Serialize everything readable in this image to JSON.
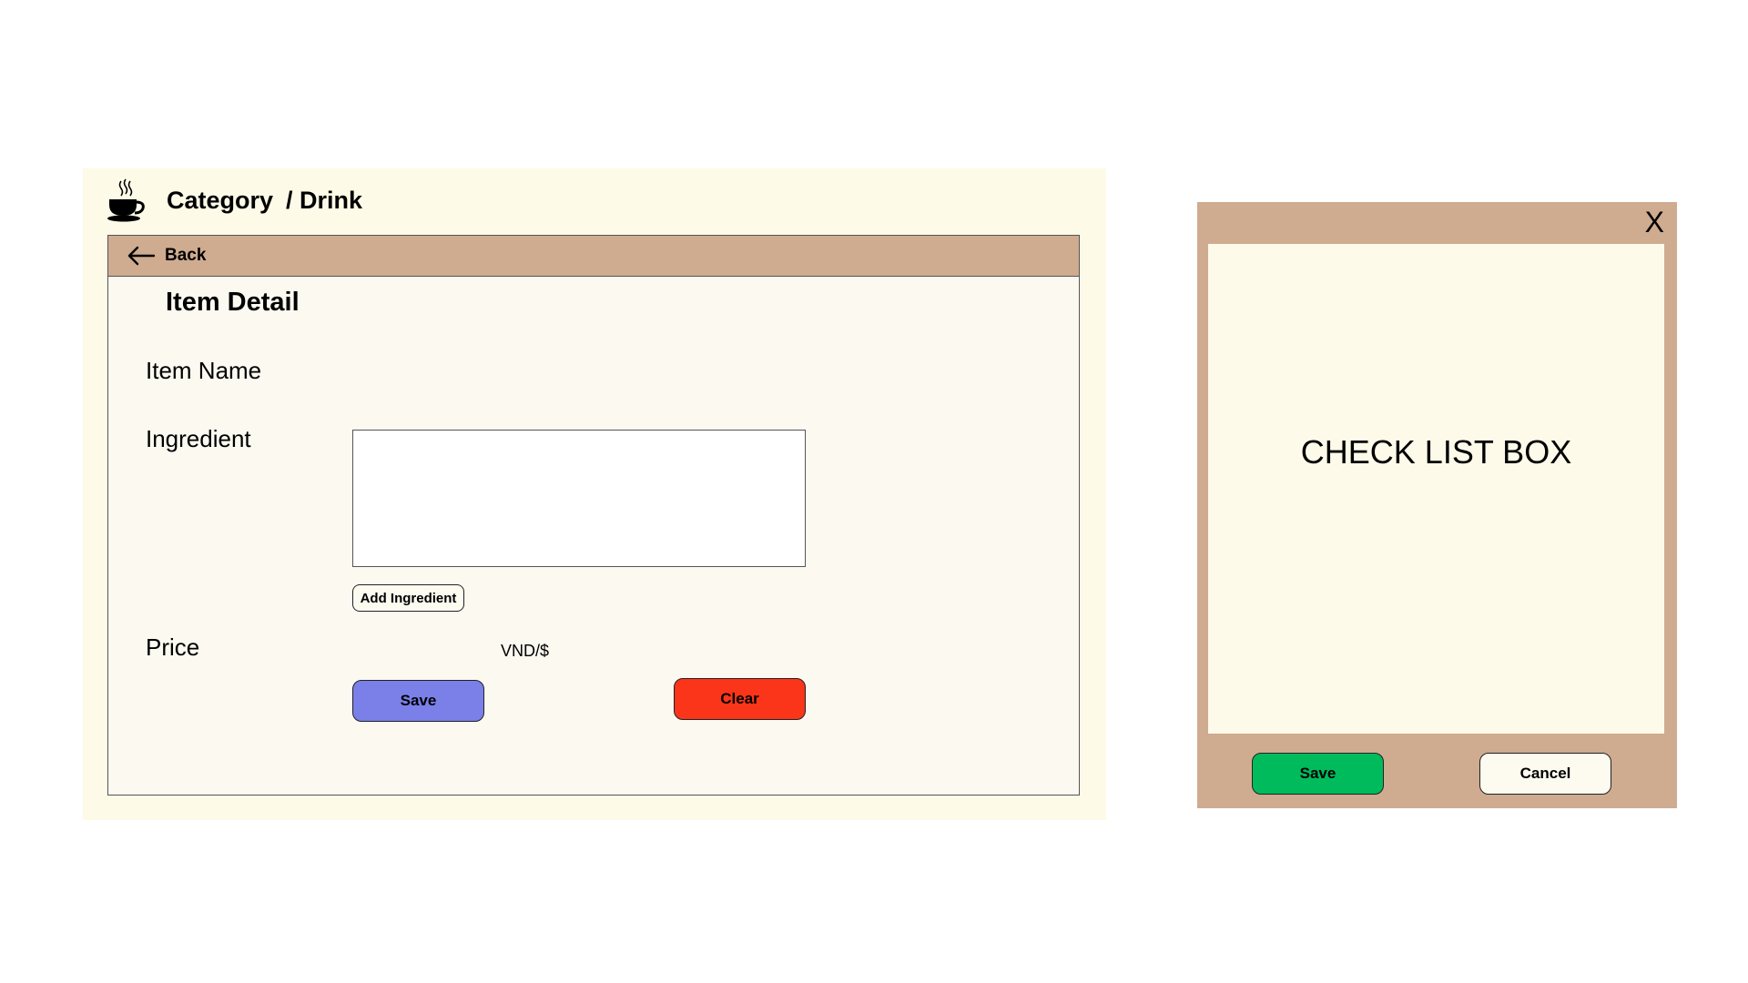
{
  "header": {
    "category": "Category",
    "separator": "/ Drink"
  },
  "nav": {
    "back_label": "Back"
  },
  "form": {
    "title": "Item Detail",
    "item_name_label": "Item Name",
    "item_name_value": "",
    "ingredient_label": "Ingredient",
    "ingredient_value": "",
    "add_ingredient_label": "Add Ingredient",
    "price_label": "Price",
    "price_value": "",
    "currency": "VND/$",
    "save_label": "Save",
    "clear_label": "Clear"
  },
  "dialog": {
    "close_label": "X",
    "box_label": "CHECK LIST BOX",
    "save_label": "Save",
    "cancel_label": "Cancel"
  },
  "colors": {
    "window_bg": "#fdfae8",
    "bar_brown": "#cfab90",
    "save_blue": "#7a80e8",
    "clear_red": "#fb3519",
    "dialog_save_green": "#00bb5c"
  },
  "icons": {
    "header": "coffee-cup-icon",
    "back": "arrow-left-icon",
    "close": "close-icon"
  }
}
